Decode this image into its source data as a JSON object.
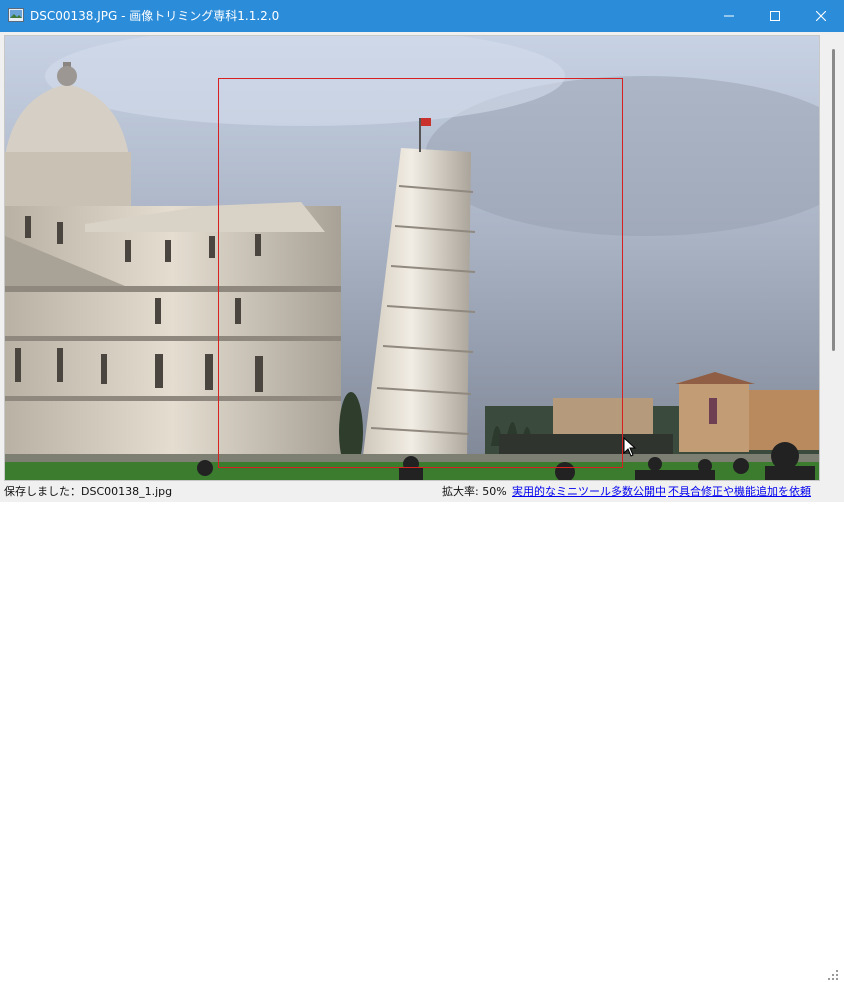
{
  "window": {
    "title": "DSC00138.JPG - 画像トリミング専科1.1.2.0",
    "app_icon": "photo-app-icon",
    "controls": [
      "minimize-icon",
      "maximize-icon",
      "close-icon"
    ]
  },
  "status": {
    "saved": "保存しました：DSC00138_1.jpg",
    "zoom": "拡大率: 50%",
    "link_tools": "実用的なミニツール多数公開中",
    "link_request": "不具合修正や機能追加を依頼"
  },
  "colors": {
    "titlebar": "#2b8cd9",
    "crop_border": "#d82020",
    "link": "#0000ee"
  }
}
